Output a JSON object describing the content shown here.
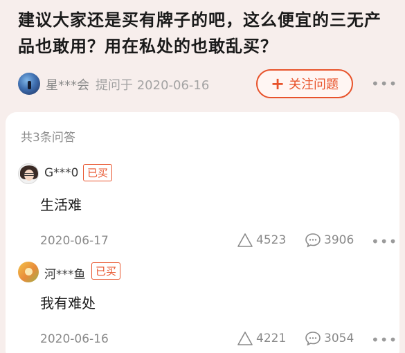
{
  "question": {
    "title": "建议大家还是买有牌子的吧，这么便宜的三无产品也敢用？用在私处的也敢乱买？",
    "asker_name": "星***会",
    "asked_at": "提问于 2020-06-16",
    "follow_label": "关注问题",
    "more_label": "•••"
  },
  "answers_section": {
    "count_label": "共3条问答",
    "items": [
      {
        "user": "G***0",
        "badge": "已买",
        "text": "生活难",
        "date": "2020-06-17",
        "likes": "4523",
        "comments": "3906",
        "more": "•••"
      },
      {
        "user": "河***鱼",
        "badge": "已买",
        "text": "我有难处",
        "date": "2020-06-16",
        "likes": "4221",
        "comments": "3054",
        "more": "•••"
      }
    ]
  },
  "colors": {
    "accent": "#e8532b",
    "header_bg": "#f7eeec",
    "muted_text": "#8a8a8a"
  }
}
